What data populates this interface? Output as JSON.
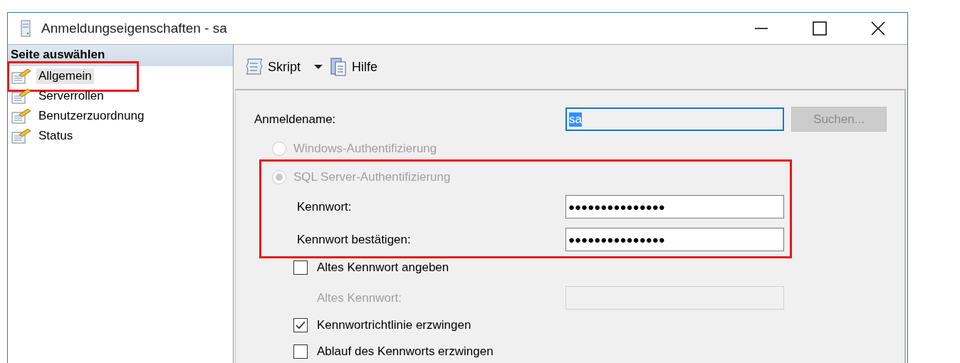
{
  "window": {
    "title": "Anmeldungseigenschaften - sa"
  },
  "sidebar": {
    "header": "Seite auswählen",
    "items": [
      {
        "label": "Allgemein",
        "selected": true,
        "highlighted": true
      },
      {
        "label": "Serverrollen",
        "selected": false,
        "highlighted": false
      },
      {
        "label": "Benutzerzuordnung",
        "selected": false,
        "highlighted": false
      },
      {
        "label": "Status",
        "selected": false,
        "highlighted": false
      }
    ]
  },
  "toolbar": {
    "script": "Skript",
    "help": "Hilfe"
  },
  "form": {
    "login_name": {
      "label": "Anmeldename:",
      "value": "sa",
      "focused": true
    },
    "search_button": {
      "label": "Suchen...",
      "disabled": true
    },
    "auth": [
      {
        "label": "Windows-Authentifizierung",
        "selected": false,
        "disabled": true
      },
      {
        "label": "SQL Server-Authentifizierung",
        "selected": true,
        "disabled": true
      }
    ],
    "auth_highlighted": true,
    "password": {
      "label": "Kennwort:",
      "value": "●●●●●●●●●●●●●●●"
    },
    "confirm_password": {
      "label": "Kennwort bestätigen:",
      "value": "●●●●●●●●●●●●●●●"
    },
    "old_password_check": {
      "label": "Altes Kennwort angeben",
      "checked": false
    },
    "old_password": {
      "label": "Altes Kennwort:",
      "disabled": true
    },
    "policy_checks": [
      {
        "label": "Kennwortrichtlinie erzwingen",
        "checked": true
      },
      {
        "label": "Ablauf des Kennworts erzwingen",
        "checked": false
      }
    ]
  }
}
